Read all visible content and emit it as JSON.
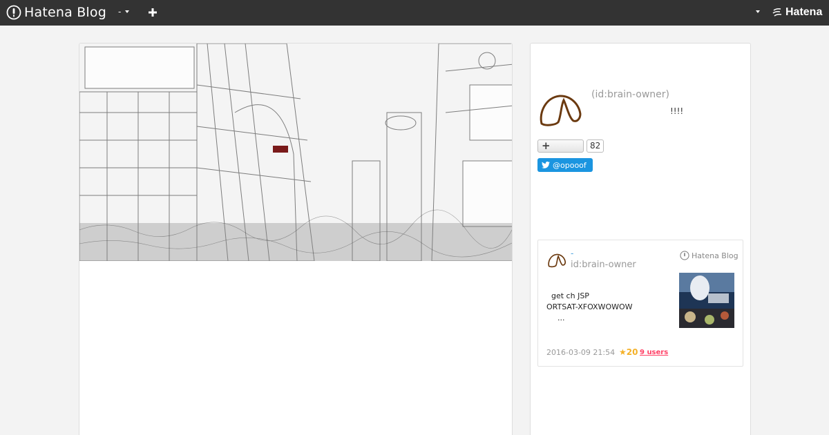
{
  "topbar": {
    "logo_text": "Hatena Blog",
    "blog_switch_label": "-",
    "brand_text": "Hatena"
  },
  "icons": {
    "logo": "hatena-blog-logo-icon",
    "blog_switch_caret": "chevron-down-icon",
    "add": "plus-icon",
    "user_menu_caret": "chevron-down-icon",
    "brand": "hatena-logo-icon",
    "follow": "plus-icon",
    "twitter": "twitter-bird-icon"
  },
  "colors": {
    "topbar_bg": "#333333",
    "twitter_blue": "#1b95e0",
    "star": "#f4b128",
    "users_link": "#ff4166"
  },
  "profile": {
    "id_text": "(id:brain-owner)",
    "description": "!!!!",
    "follow_count": "82",
    "twitter_handle": "@opooof"
  },
  "card": {
    "dash": "-",
    "id_text": "id:brain-owner",
    "brand": "Hatena Blog",
    "text_line1": "get ch JSP",
    "text_line2": "ORTSAT-XFOXWOWOW",
    "text_line3": "...",
    "date": "2016-03-09 21:54",
    "stars": "★20",
    "users": "9 users"
  }
}
